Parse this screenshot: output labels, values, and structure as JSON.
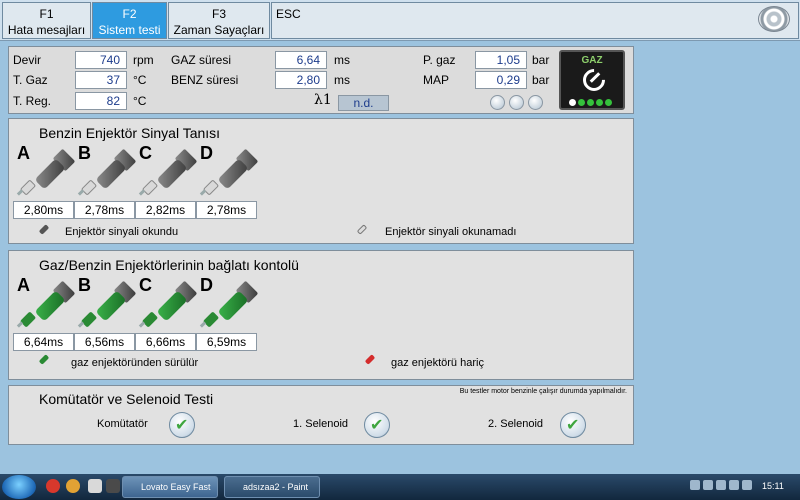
{
  "tabs": [
    {
      "key": "F1",
      "label": "Hata mesajları"
    },
    {
      "key": "F2",
      "label": "Sistem testi",
      "active": true
    },
    {
      "key": "F3",
      "label": "Zaman Sayaçları"
    },
    {
      "key": "ESC",
      "label": ""
    }
  ],
  "status": {
    "rows": [
      {
        "label": "Devir",
        "value": "740",
        "unit": "rpm"
      },
      {
        "label": "T. Gaz",
        "value": "37",
        "unit": "°C"
      },
      {
        "label": "T. Reg.",
        "value": "82",
        "unit": "°C"
      }
    ],
    "times": [
      {
        "label": "GAZ süresi",
        "value": "6,64",
        "unit": "ms"
      },
      {
        "label": "BENZ süresi",
        "value": "2,80",
        "unit": "ms"
      }
    ],
    "lambda_label": "λ1",
    "lambda_value": "n.d.",
    "pressures": [
      {
        "label": "P. gaz",
        "value": "1,05",
        "unit": "bar"
      },
      {
        "label": "MAP",
        "value": "0,29",
        "unit": "bar"
      }
    ],
    "gaz_logo_text": "GAZ",
    "led_colors": [
      "#ffffff",
      "#35c23c",
      "#35c23c",
      "#35c23c",
      "#35c23c"
    ]
  },
  "benzin": {
    "title": "Benzin Enjektör Sinyal Tanısı",
    "injectors": [
      {
        "letter": "A",
        "value": "2,80ms"
      },
      {
        "letter": "B",
        "value": "2,78ms"
      },
      {
        "letter": "C",
        "value": "2,82ms"
      },
      {
        "letter": "D",
        "value": "2,78ms"
      }
    ],
    "legend_ok": "Enjektör sinyali okundu",
    "legend_fail": "Enjektör sinyali okunamadı"
  },
  "gas": {
    "title": "Gaz/Benzin Enjektörlerinin bağlatı kontolü",
    "injectors": [
      {
        "letter": "A",
        "value": "6,64ms"
      },
      {
        "letter": "B",
        "value": "6,56ms"
      },
      {
        "letter": "C",
        "value": "6,66ms"
      },
      {
        "letter": "D",
        "value": "6,59ms"
      }
    ],
    "legend_ok": "gaz enjektöründen sürülür",
    "legend_fail": "gaz enjektörü hariç"
  },
  "komutator": {
    "title": "Komütatör ve Selenoid Testi",
    "note": "Bu testler motor benzinle çalışır durumda yapılmalıdır.",
    "items": [
      "Komütatör",
      "1. Selenoid",
      "2. Selenoid"
    ]
  },
  "taskbar": {
    "tasks": [
      "Lovato Easy Fast",
      "adsızaa2 - Paint"
    ],
    "clock": "15:11"
  }
}
